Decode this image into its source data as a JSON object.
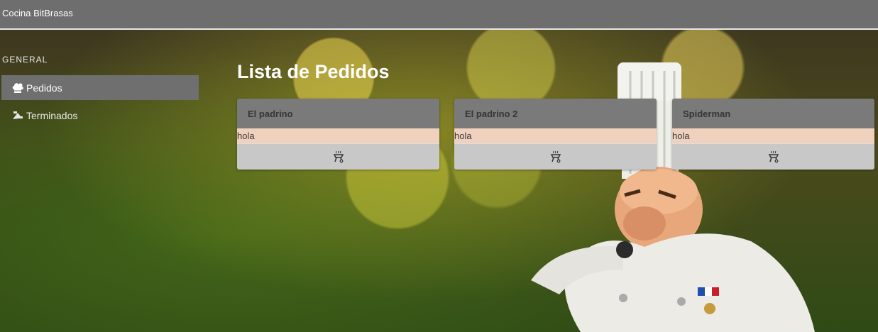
{
  "app": {
    "title": "Cocina BitBrasas"
  },
  "sidebar": {
    "section": "GENERAL",
    "items": [
      {
        "label": "Pedidos",
        "icon": "chef-hat-icon",
        "active": true
      },
      {
        "label": "Terminados",
        "icon": "serving-tray-icon",
        "active": false
      }
    ]
  },
  "main": {
    "title": "Lista de Pedidos",
    "orders": [
      {
        "name": "El padrino",
        "note": "hola",
        "action_icon": "grill-icon"
      },
      {
        "name": "El padrino 2",
        "note": "hola",
        "action_icon": "grill-icon"
      },
      {
        "name": "Spiderman",
        "note": "hola",
        "action_icon": "grill-icon"
      }
    ]
  },
  "colors": {
    "topbar": "#6e6e6e",
    "card_header": "#7a7a7a",
    "card_note": "#efd1bd",
    "card_footer": "#c8c8c8"
  }
}
